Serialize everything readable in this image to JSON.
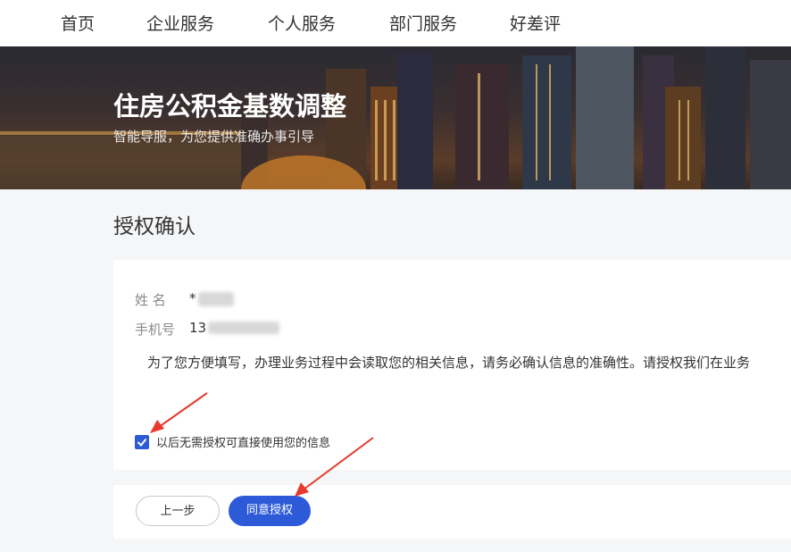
{
  "nav": {
    "items": [
      {
        "label": "首页"
      },
      {
        "label": "企业服务"
      },
      {
        "label": "个人服务"
      },
      {
        "label": "部门服务"
      },
      {
        "label": "好差评"
      }
    ]
  },
  "banner": {
    "title": "住房公积金基数调整",
    "subtitle": "智能导服，为您提供准确办事引导"
  },
  "section": {
    "title": "授权确认"
  },
  "form": {
    "name_label": "姓 名",
    "name_value": "*",
    "phone_label": "手机号",
    "phone_value": "13",
    "notice": "为了您方便填写，办理业务过程中会读取您的相关信息，请务必确认信息的准确性。请授权我们在业务"
  },
  "consent": {
    "checked": true,
    "label": "以后无需授权可直接使用您的信息"
  },
  "actions": {
    "prev_label": "上一步",
    "agree_label": "同意授权"
  },
  "colors": {
    "primary": "#2d5bd8",
    "annotation": "#e63a2e"
  }
}
